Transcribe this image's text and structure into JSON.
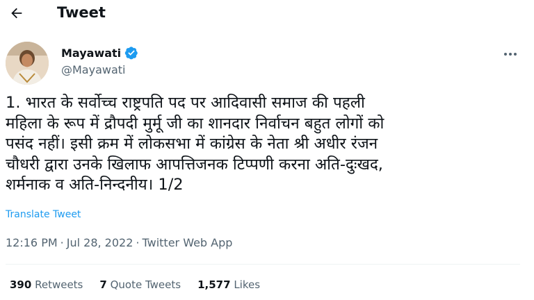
{
  "header": {
    "title": "Tweet",
    "back_icon": "arrow-left-icon"
  },
  "author": {
    "display_name": "Mayawati",
    "handle": "@Mayawati",
    "verified_color": "#1d9bf0",
    "avatar_icon": "profile-photo"
  },
  "tweet": {
    "text": "1. भारत के सर्वोच्च राष्ट्रपति पद पर आदिवासी समाज की पहली\nमहिला के रूप में द्रौपदी मुर्मू जी का शानदार निर्वाचन बहुत लोगों को\nपसंद नहीं। इसी क्रम में लोकसभा में कांग्रेस के नेता श्री अधीर रंजन\nचौधरी द्वारा उनके खिलाफ आपत्तिजनक टिप्पणी करना अति-दुःखद,\nशर्मनाक व अति-निन्दनीय। 1/2",
    "translate_label": "Translate Tweet",
    "time": "12:16 PM",
    "date": "Jul 28, 2022",
    "source": "Twitter Web App",
    "separator": "·"
  },
  "stats": {
    "retweets_count": "390",
    "retweets_label": "Retweets",
    "quotes_count": "7",
    "quotes_label": "Quote Tweets",
    "likes_count": "1,577",
    "likes_label": "Likes"
  },
  "colors": {
    "link": "#1d9bf0",
    "secondary_text": "#536471",
    "primary_text": "#0f1419"
  }
}
